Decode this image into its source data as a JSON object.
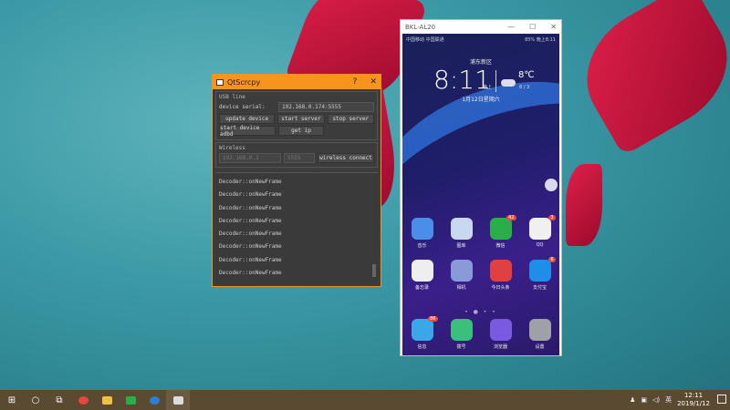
{
  "qtscrcpy": {
    "title": "QtScrcpy",
    "help": "?",
    "close": "✕",
    "usb_group": "USB line",
    "serial_label": "device serial:",
    "serial_value": "192.168.0.174:5555",
    "buttons": [
      "update device",
      "start server",
      "stop server",
      "start device adbd",
      "get ip"
    ],
    "wireless_group": "Wireless",
    "ip_placeholder": "192.168.0.1",
    "port_placeholder": "5555",
    "wireless_connect": "wireless connect",
    "log": [
      "Decoder::onNewFrame",
      "Decoder::onNewFrame",
      "Decoder::onNewFrame",
      "Decoder::onNewFrame",
      "Decoder::onNewFrame",
      "Decoder::onNewFrame",
      "Decoder::onNewFrame",
      "Decoder::onNewFrame"
    ],
    "accent": "#f7941d"
  },
  "phone": {
    "title": "BKL-AL20",
    "minimize": "—",
    "maximize": "☐",
    "close": "✕",
    "status_left": "中国移动 中国联通",
    "status_right": "85% 晚上8:11",
    "location": "浦东新区",
    "time": "8:11",
    "period": "晚上",
    "temp": "8℃",
    "range": "8 / 3",
    "date": "1月12日星期六",
    "apps_row1": [
      {
        "name": "音乐",
        "color": "#4a8ee8"
      },
      {
        "name": "图库",
        "color": "#c8d8f0"
      },
      {
        "name": "微信",
        "color": "#2aae4a",
        "badge": "42"
      },
      {
        "name": "QQ",
        "color": "#f0f0f0",
        "badge": "3"
      }
    ],
    "apps_row2": [
      {
        "name": "备忘录",
        "color": "#eeeeee"
      },
      {
        "name": "相机",
        "color": "#8a9ad8"
      },
      {
        "name": "今日头条",
        "color": "#e04040"
      },
      {
        "name": "支付宝",
        "color": "#1e8ee8",
        "badge": "6"
      }
    ],
    "dock": [
      {
        "name": "信息",
        "color": "#3aa8e8",
        "badge": "86"
      },
      {
        "name": "拨号",
        "color": "#3ac07a"
      },
      {
        "name": "浏览器",
        "color": "#7a5ae0"
      },
      {
        "name": "设置",
        "color": "#a0a0a8"
      }
    ],
    "page_dots": "• ● • •"
  },
  "taskbar": {
    "time": "12:11",
    "date": "2019/1/12"
  }
}
